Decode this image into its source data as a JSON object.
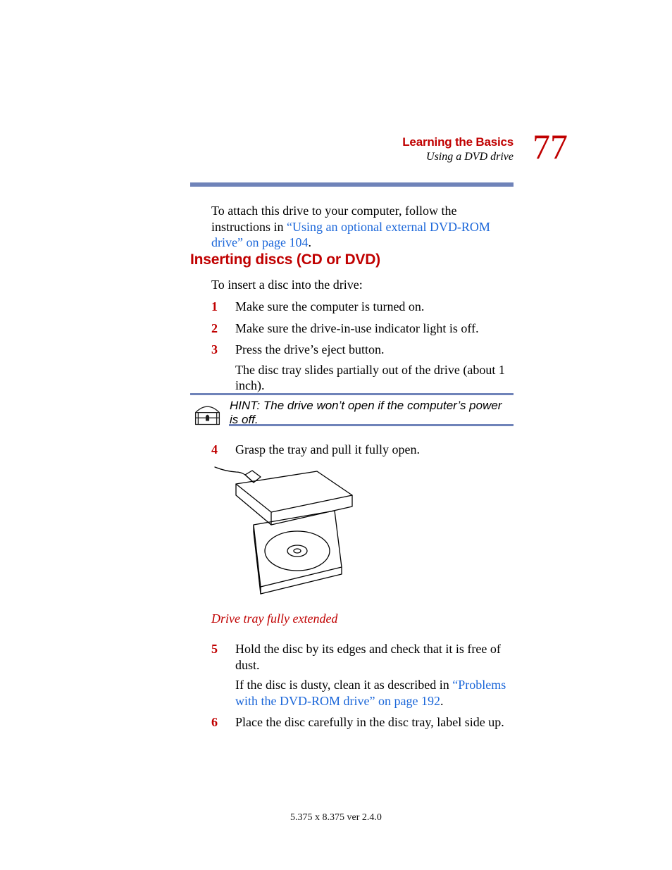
{
  "header": {
    "chapter": "Learning the Basics",
    "section": "Using a DVD drive",
    "page_number": "77"
  },
  "paragraphs": {
    "p1_pre": "To attach this drive to your computer, follow the instructions in ",
    "p1_link": "“Using an optional external DVD-ROM drive” on page 104",
    "p1_post": ".",
    "intro": "To insert a disc into the drive:"
  },
  "heading2": "Inserting discs (CD or DVD)",
  "list1": [
    {
      "n": "1",
      "t": "Make sure the computer is turned on."
    },
    {
      "n": "2",
      "t": "Make sure the drive-in-use indicator light is off."
    },
    {
      "n": "3",
      "t": "Press the drive’s eject button."
    }
  ],
  "list1_extra": "The disc tray slides partially out of the drive (about 1 inch).",
  "hint": {
    "label": "HINT: ",
    "text": "The drive won’t open if the computer’s power is off."
  },
  "list2a": {
    "n": "4",
    "t": "Grasp the tray and pull it fully open."
  },
  "caption": "Drive tray fully extended",
  "list2b": [
    {
      "n": "5",
      "t": "Hold the disc by its edges and check that it is free of dust.",
      "extra_pre": "If the disc is dusty, clean it as described in ",
      "extra_link": "“Problems with the DVD-ROM drive” on page 192",
      "extra_post": "."
    },
    {
      "n": "6",
      "t": "Place the disc carefully in the disc tray, label side up."
    }
  ],
  "footer": "5.375 x 8.375 ver 2.4.0",
  "icons": {
    "hint": "treasure-chest-icon",
    "figure": "dvd-drive-tray-illustration"
  }
}
